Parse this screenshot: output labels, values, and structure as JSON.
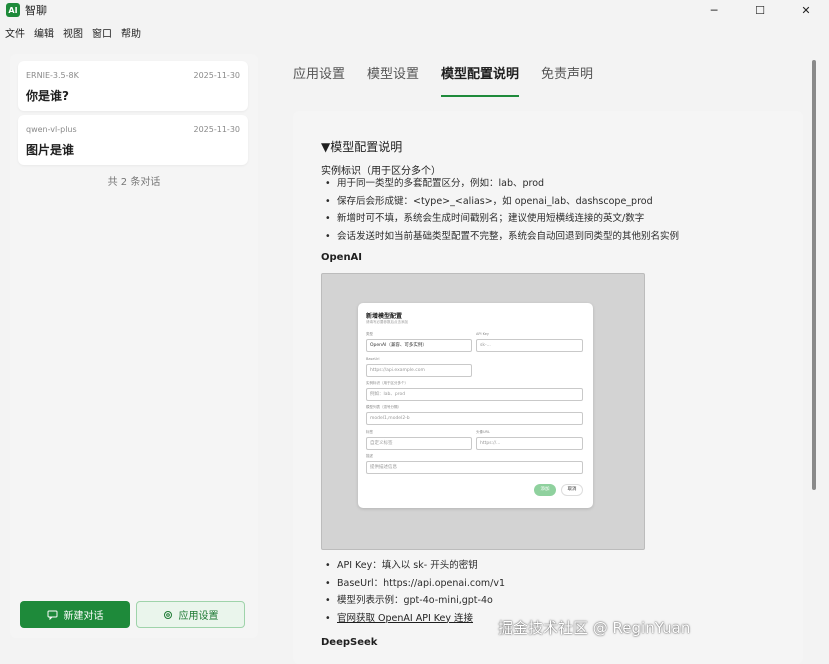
{
  "window": {
    "title": "智聊",
    "logo_text": "AI",
    "controls": {
      "minimize": "─",
      "maximize": "☐",
      "close": "✕"
    }
  },
  "menu": [
    "文件",
    "编辑",
    "视图",
    "窗口",
    "帮助"
  ],
  "sidebar": {
    "conversations": [
      {
        "model": "ERNIE-3.5-8K",
        "date": "2025-11-30",
        "title": "你是谁?"
      },
      {
        "model": "qwen-vl-plus",
        "date": "2025-11-30",
        "title": "图片是谁"
      }
    ],
    "count_text": "共 2 条对话",
    "new_chat_label": "新建对话",
    "settings_label": "应用设置"
  },
  "tabs": [
    {
      "label": "应用设置",
      "active": false
    },
    {
      "label": "模型设置",
      "active": false
    },
    {
      "label": "模型配置说明",
      "active": true
    },
    {
      "label": "免责声明",
      "active": false
    }
  ],
  "doc": {
    "heading": "▼模型配置说明",
    "instance_heading": "实例标识（用于区分多个）",
    "instance_bullets": [
      "用于同一类型的多套配置区分，例如：lab、prod",
      "保存后会形成键：<type>_<alias>，如 openai_lab、dashscope_prod",
      "新增时可不填，系统会生成时间戳别名；建议使用短横线连接的英文/数字",
      "会话发送时如当前基础类型配置不完整，系统会自动回退到同类型的其他别名实例"
    ],
    "openai_label": "OpenAI",
    "openai_bullets": [
      "API Key：填入以 sk- 开头的密钥",
      "BaseUrl：https://api.openai.com/v1",
      "模型列表示例：gpt-4o-mini,gpt-4o"
    ],
    "openai_link": "官网获取 OpenAI API Key 连接",
    "deepseek_label": "DeepSeek"
  },
  "figure_dialog": {
    "title": "新增模型配置",
    "subtitle": "请填写必要参数后点击添加",
    "type_label": "类型",
    "type_value": "OpenAI（兼容、可多实例）",
    "apikey_label": "API Key",
    "apikey_placeholder": "sk-...",
    "baseurl_label": "BaseUrl",
    "baseurl_placeholder": "https://api.example.com",
    "instance_label": "实例标识（用于区分多个）",
    "instance_placeholder": "例如：lab、prod",
    "models_label": "模型列表（逗号分隔）",
    "models_placeholder": "model1,model2-b",
    "tag_label": "标签",
    "tag_placeholder": "自定义标签",
    "icon_label": "头像URL",
    "icon_placeholder": "https://...",
    "desc_label": "描述",
    "desc_placeholder": "提供描述信息",
    "ok_label": "添加",
    "cancel_label": "取消"
  },
  "watermark": "掘金技术社区 @ ReginYuan",
  "colors": {
    "accent": "#1e8a3a",
    "accent_light": "#eaf5ec"
  }
}
